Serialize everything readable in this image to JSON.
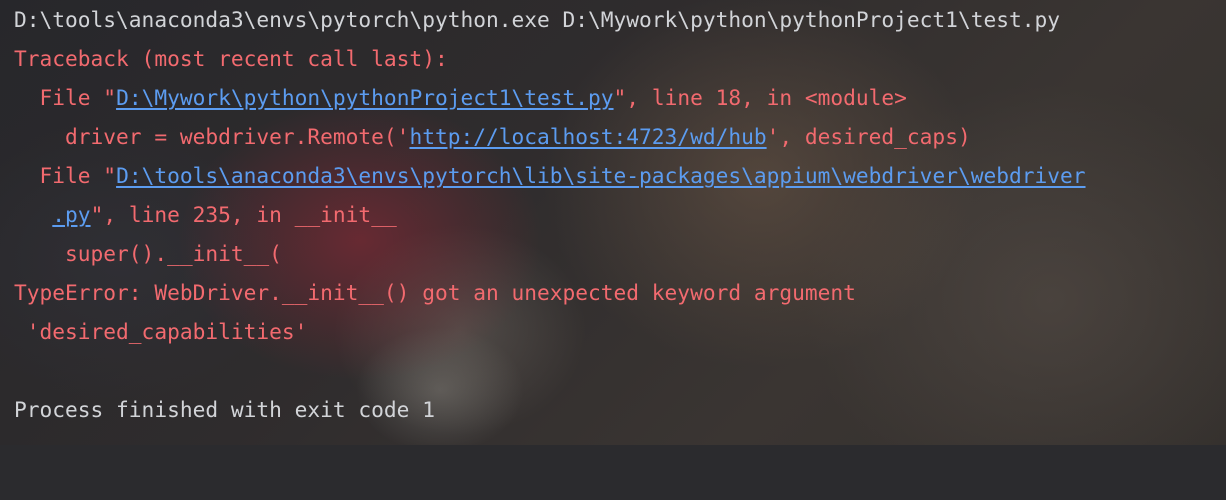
{
  "console": {
    "command": "D:\\tools\\anaconda3\\envs\\pytorch\\python.exe D:\\Mywork\\python\\pythonProject1\\test.py",
    "traceback_header": "Traceback (most recent call last):",
    "frame1": {
      "prefix": "  File \"",
      "path": "D:\\Mywork\\python\\pythonProject1\\test.py",
      "suffix": "\", line 18, in <module>",
      "code_prefix": "    driver = webdriver.Remote('",
      "code_url": "http://localhost:4723/wd/hub",
      "code_suffix": "', desired_caps)"
    },
    "frame2": {
      "prefix": "  File \"",
      "path_part1": "D:\\tools\\anaconda3\\envs\\pytorch\\lib\\site-packages\\appium\\webdriver\\webdriver",
      "indent": "   ",
      "path_part2": ".py",
      "suffix": "\", line 235, in __init__",
      "code": "    super().__init__("
    },
    "error_line1": "TypeError: WebDriver.__init__() got an unexpected keyword argument",
    "error_line2": " 'desired_capabilities'",
    "exit_message": "Process finished with exit code 1"
  },
  "colors": {
    "plain_text": "#d2d4d8",
    "error_text": "#f26a6f",
    "link_text": "#5c9cf0"
  }
}
